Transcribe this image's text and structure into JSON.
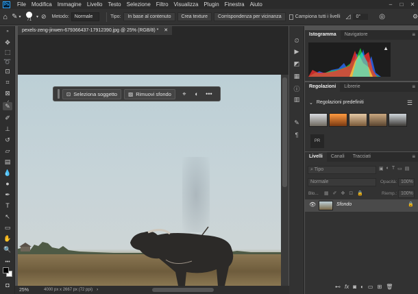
{
  "app": {
    "logo": "Ps",
    "menu": [
      "File",
      "Modifica",
      "Immagine",
      "Livello",
      "Testo",
      "Selezione",
      "Filtro",
      "Visualizza",
      "Plugin",
      "Finestra",
      "Aiuto"
    ],
    "window_controls": [
      "–",
      "□",
      "✕"
    ]
  },
  "options_bar": {
    "brush_size": "71",
    "metodo_label": "Metodo:",
    "metodo_value": "Normale",
    "tipo_label": "Tipo:",
    "tipo_options": [
      "In base al contenuto",
      "Crea texture",
      "Corrispondenza per vicinanza"
    ],
    "sample_all_label": "Campiona tutti i livelli",
    "angle_value": "0°"
  },
  "document": {
    "tab_title": "pexels-zeng-jinwen-679366437-17912390.jpg @ 25% (RGB/8) *",
    "zoom": "25%",
    "doc_info": "4000 px x 2667 px (72 ppi)"
  },
  "context_bar": {
    "select_subject": "Seleziona soggetto",
    "remove_bg": "Rimuovi sfondo"
  },
  "histogram_panel": {
    "tabs": [
      "Istogramma",
      "Navigatore"
    ]
  },
  "adjust_panel": {
    "tabs": [
      "Regolazioni",
      "Librerie"
    ],
    "section_title": "Regolazioni predefiniti",
    "more_label": "PR"
  },
  "layers_panel": {
    "tabs": [
      "Livelli",
      "Canali",
      "Tracciati"
    ],
    "search_placeholder": "Tipo",
    "blend_mode": "Normale",
    "opacity_label": "Opacità:",
    "opacity_value": "100%",
    "lock_label": "Blo...",
    "fill_label": "Riemp.:",
    "fill_value": "100%",
    "layers": [
      {
        "name": "Sfondo"
      }
    ],
    "bottom_icons": [
      "link-icon",
      "fx-icon",
      "mask-icon",
      "adjustment-icon",
      "group-icon",
      "new-layer-icon",
      "trash-icon"
    ]
  },
  "colors": {
    "accent": "#31a8ff",
    "panel_bg": "#323232",
    "app_bg": "#535353"
  }
}
